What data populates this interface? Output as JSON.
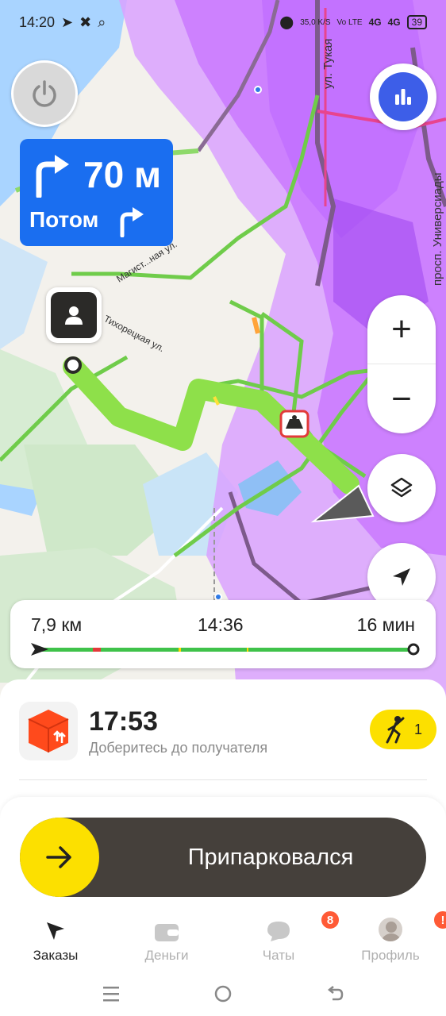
{
  "status_bar": {
    "time": "14:20",
    "net_speed": "35,0 K/S",
    "volte": "Vo LTE",
    "signal1": "4G",
    "signal2": "4G",
    "battery": "39"
  },
  "map": {
    "street_labels": [
      "ул. Тукая",
      "просп. Универсиады",
      "Магист...ная ул.",
      "Тихорецкая ул."
    ],
    "colors": {
      "route": "#8ee04a",
      "traffic_green": "#6fd046",
      "heatmap": "#c772ff",
      "water": "#a9d4ff"
    }
  },
  "maneuver": {
    "distance": "70 м",
    "then_label": "Потом",
    "turn": "right"
  },
  "controls": {
    "zoom_in": "+",
    "zoom_out": "−"
  },
  "route_summary": {
    "distance": "7,9 км",
    "arrival_time": "14:36",
    "duration": "16 мин"
  },
  "order": {
    "eta": "17:53",
    "subtitle": "Доберитесь до получателя",
    "walkers_count": "1"
  },
  "action": {
    "slider_label": "Припарковался"
  },
  "tabs": [
    {
      "label": "Заказы",
      "active": true,
      "badge": ""
    },
    {
      "label": "Деньги",
      "active": false,
      "badge": ""
    },
    {
      "label": "Чаты",
      "active": false,
      "badge": "8"
    },
    {
      "label": "Профиль",
      "active": false,
      "badge": "!"
    }
  ],
  "accent_colors": {
    "yellow": "#fce000",
    "blue": "#1a6ef0",
    "badge_red": "#ff5a36"
  }
}
